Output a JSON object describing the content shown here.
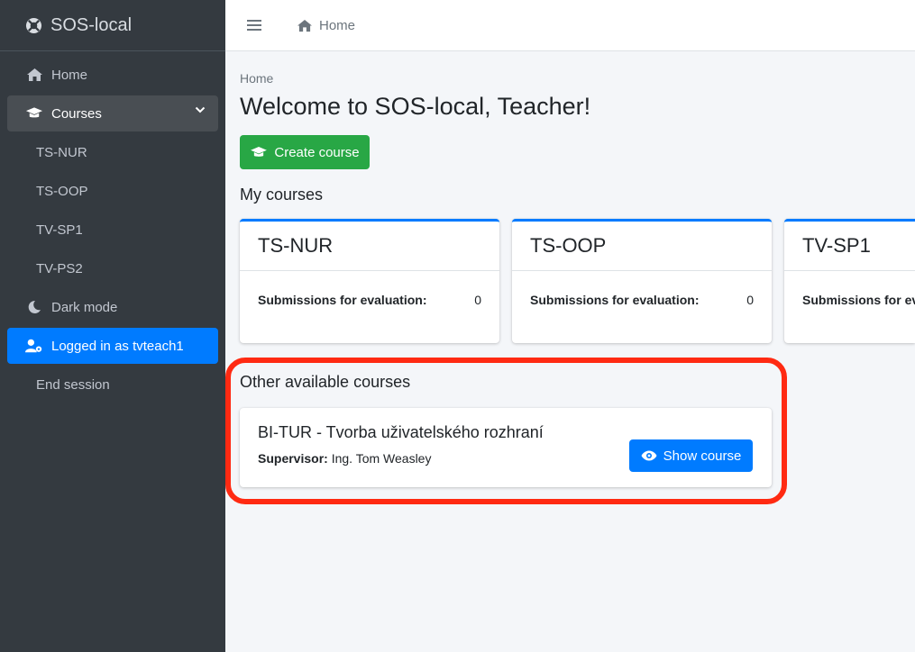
{
  "brand": {
    "name": "SOS-local",
    "icon": "life-ring-icon"
  },
  "sidebar": {
    "items": [
      {
        "label": "Home",
        "icon": "home-icon"
      },
      {
        "label": "Courses",
        "icon": "graduation-cap-icon"
      },
      {
        "label": "TS-NUR"
      },
      {
        "label": "TS-OOP"
      },
      {
        "label": "TV-SP1"
      },
      {
        "label": "TV-PS2"
      },
      {
        "label": "Dark mode",
        "icon": "moon-icon"
      },
      {
        "label": "Logged in as tvteach1",
        "icon": "user-cog-icon"
      },
      {
        "label": "End session"
      }
    ]
  },
  "topbar": {
    "home_label": "Home"
  },
  "main": {
    "breadcrumb": "Home",
    "title": "Welcome to SOS-local, Teacher!",
    "create_label": "Create course",
    "my_courses_title": "My courses",
    "courses": [
      {
        "code": "TS-NUR",
        "label": "Submissions for evaluation:",
        "count": "0"
      },
      {
        "code": "TS-OOP",
        "label": "Submissions for evaluation:",
        "count": "0"
      },
      {
        "code": "TV-SP1",
        "label": "Submissions for evaluation:",
        "count": ""
      }
    ],
    "other_title": "Other available courses",
    "other": {
      "name": "BI-TUR - Tvorba uživatelského rozhraní",
      "supervisor_label": "Supervisor:",
      "supervisor": "Ing. Tom Weasley",
      "show_label": "Show course"
    }
  },
  "colors": {
    "sidebar": "#343a40",
    "accent": "#007bff",
    "success": "#28a745",
    "highlight": "#ff2a12"
  }
}
